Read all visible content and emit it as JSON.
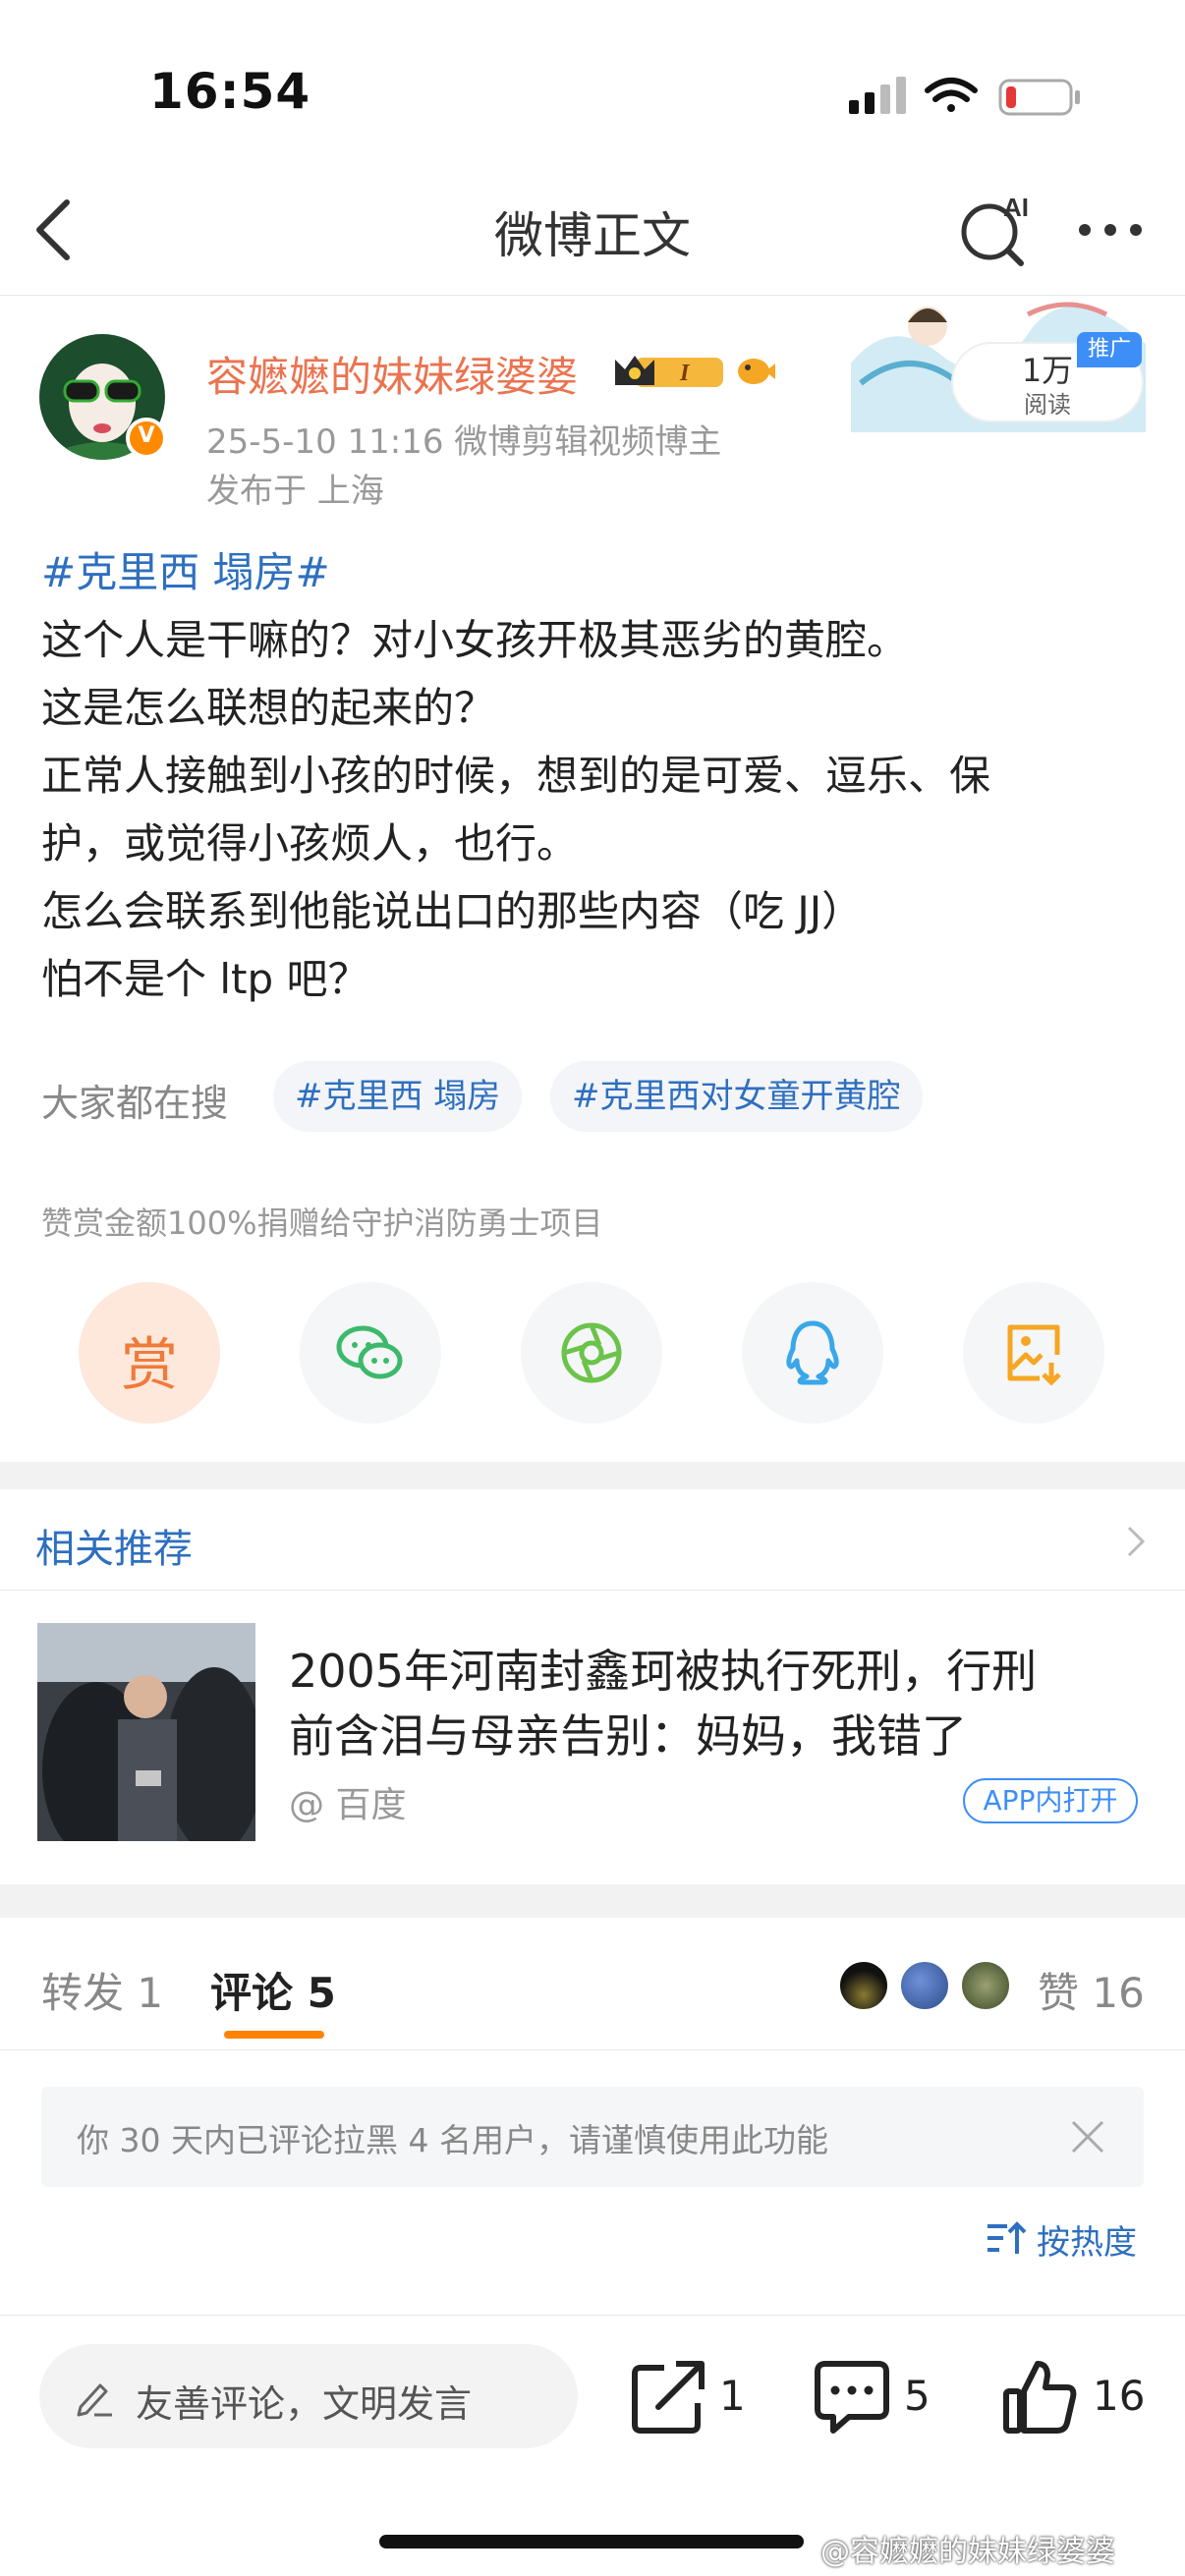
{
  "status_bar": {
    "time": "16:54"
  },
  "nav": {
    "title": "微博正文"
  },
  "author": {
    "name": "容嬷嬷的妹妹绿婆婆",
    "meta": "25-5-10 11:16  微博剪辑视频博主",
    "location": "发布于 上海",
    "badge_level": "I"
  },
  "promo": {
    "read_count": "1万",
    "read_label": "阅读",
    "tag": "推广"
  },
  "post": {
    "topic": "#克里西 塌房#",
    "lines": [
      "这个人是干嘛的？对小女孩开极其恶劣的黄腔。",
      "这是怎么联想的起来的？",
      "正常人接触到小孩的时候，想到的是可爱、逗乐、保",
      "护，或觉得小孩烦人，也行。",
      "怎么会联系到他能说出口的那些内容（吃 JJ）",
      "怕不是个 ltp 吧？"
    ]
  },
  "trending": {
    "label": "大家都在搜",
    "chips": [
      "#克里西 塌房",
      "#克里西对女童开黄腔"
    ]
  },
  "donate_note": "赞赏金额100%捐赠给守护消防勇士项目",
  "share": {
    "reward_glyph": "赏"
  },
  "related": {
    "title": "相关推荐",
    "headline_1": "2005年河南封鑫珂被执行死刑，行刑",
    "headline_2": "前含泪与母亲告别：妈妈，我错了",
    "source": "@ 百度",
    "app_open": "APP内打开"
  },
  "tabs": {
    "repost": "转发 1",
    "comments": "评论 5",
    "likes": "赞 16"
  },
  "notice": "你 30 天内已评论拉黑 4 名用户，请谨慎使用此功能",
  "sort": {
    "label": "按热度"
  },
  "bottom_bar": {
    "placeholder": "友善评论，文明发言",
    "repost_count": "1",
    "comment_count": "5",
    "like_count": "16"
  },
  "watermark": "@容嬷嬷的妹妹绿婆婆",
  "colors": {
    "accent_orange": "#eb7350",
    "link_blue": "#2e6fbf",
    "tab_underline": "#ff8200"
  }
}
